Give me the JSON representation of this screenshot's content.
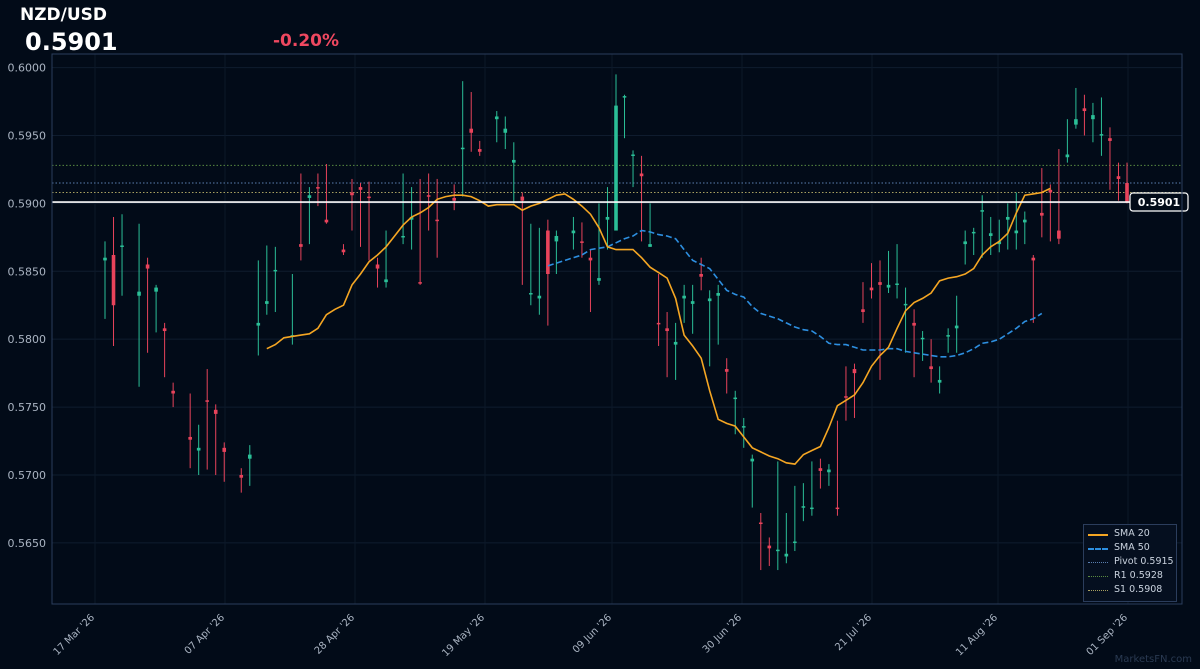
{
  "header": {
    "pair": "NZD/USD",
    "price": "0.5901",
    "change": "-0.20%"
  },
  "watermark": "MarketsFN.com",
  "colors": {
    "up": "#2bbf97",
    "down": "#e8435b",
    "sma20": "#f5a623",
    "sma50": "#2d8fe0",
    "pivot": "#5a7fb0",
    "r1": "#5a8a40",
    "s1": "#a8a060",
    "frame": "#2b3d5c"
  },
  "legend": [
    {
      "label": "SMA 20",
      "style": "sma20"
    },
    {
      "label": "SMA 50",
      "style": "sma50"
    },
    {
      "label": "Pivot 0.5915",
      "style": "pivot"
    },
    {
      "label": "R1 0.5928",
      "style": "r1"
    },
    {
      "label": "S1 0.5908",
      "style": "s1"
    }
  ],
  "chart_data": {
    "type": "candlestick",
    "title": "NZD/USD",
    "ylim": [
      0.5605,
      0.601
    ],
    "y_ticks": [
      0.565,
      0.57,
      0.575,
      0.58,
      0.585,
      0.59,
      0.595,
      0.6
    ],
    "y_tick_labels": [
      "0.5650",
      "0.5700",
      "0.5750",
      "0.5800",
      "0.5850",
      "0.5900",
      "0.5950",
      "0.6000"
    ],
    "x_tick_labels": [
      "17 Mar '26",
      "07 Apr '26",
      "28 Apr '26",
      "19 May '26",
      "09 Jun '26",
      "30 Jun '26",
      "21 Jul '26",
      "11 Aug '26",
      "01 Sep '26"
    ],
    "x_tick_index": [
      0,
      21,
      42,
      63,
      84,
      105,
      126,
      147,
      168
    ],
    "last_price": 0.5901,
    "last_price_label": "0.5901",
    "levels": [
      {
        "name": "Pivot",
        "value": 0.5915
      },
      {
        "name": "R1",
        "value": 0.5928
      },
      {
        "name": "S1",
        "value": 0.5908
      }
    ],
    "grid": true,
    "legend_position": "bottom-right",
    "days": 172,
    "series_candles_note": "OHLC per trading bar",
    "candles": [
      [
        0,
        0.5858,
        0.5872,
        0.5815,
        0.586
      ],
      [
        1,
        0.5862,
        0.589,
        0.5795,
        0.5825
      ],
      [
        2,
        0.5868,
        0.5892,
        0.5832,
        0.5869
      ],
      [
        4,
        0.5832,
        0.5885,
        0.5765,
        0.5835
      ],
      [
        5,
        0.5855,
        0.586,
        0.579,
        0.5852
      ],
      [
        6,
        0.5835,
        0.584,
        0.5805,
        0.5838
      ],
      [
        7,
        0.5808,
        0.5812,
        0.5772,
        0.5806
      ],
      [
        8,
        0.5762,
        0.5768,
        0.575,
        0.576
      ],
      [
        10,
        0.5728,
        0.576,
        0.5705,
        0.5726
      ],
      [
        11,
        0.5718,
        0.5737,
        0.57,
        0.572
      ],
      [
        12,
        0.5755,
        0.5778,
        0.5704,
        0.5754
      ],
      [
        13,
        0.5748,
        0.5752,
        0.57,
        0.5745
      ],
      [
        14,
        0.572,
        0.5724,
        0.5695,
        0.5717
      ],
      [
        16,
        0.57,
        0.5705,
        0.5687,
        0.5698
      ],
      [
        17,
        0.5712,
        0.5722,
        0.5692,
        0.5715
      ],
      [
        18,
        0.581,
        0.5858,
        0.5788,
        0.5812
      ],
      [
        19,
        0.5826,
        0.5869,
        0.5818,
        0.5828
      ],
      [
        20,
        0.585,
        0.5868,
        0.582,
        0.5851
      ],
      [
        22,
        0.5802,
        0.5848,
        0.5796,
        0.5803
      ],
      [
        23,
        0.587,
        0.5922,
        0.5858,
        0.5868
      ],
      [
        24,
        0.5904,
        0.5912,
        0.587,
        0.5906
      ],
      [
        25,
        0.5912,
        0.5922,
        0.5898,
        0.5911
      ],
      [
        26,
        0.5888,
        0.5929,
        0.5885,
        0.5886
      ],
      [
        28,
        0.5866,
        0.587,
        0.5862,
        0.5864
      ],
      [
        29,
        0.5908,
        0.5918,
        0.588,
        0.5906
      ],
      [
        30,
        0.5912,
        0.5915,
        0.5868,
        0.591
      ],
      [
        31,
        0.5905,
        0.5916,
        0.5858,
        0.5904
      ],
      [
        32,
        0.5855,
        0.586,
        0.5838,
        0.5852
      ],
      [
        33,
        0.5842,
        0.588,
        0.5838,
        0.5844
      ],
      [
        35,
        0.5875,
        0.5922,
        0.587,
        0.5876
      ],
      [
        36,
        0.5888,
        0.5912,
        0.5866,
        0.589
      ],
      [
        37,
        0.5842,
        0.5918,
        0.584,
        0.5841
      ],
      [
        38,
        0.5906,
        0.5922,
        0.588,
        0.5905
      ],
      [
        39,
        0.5888,
        0.5918,
        0.586,
        0.5887
      ],
      [
        41,
        0.5904,
        0.5914,
        0.5895,
        0.5902
      ],
      [
        42,
        0.594,
        0.599,
        0.5905,
        0.5941
      ],
      [
        43,
        0.5955,
        0.5982,
        0.5938,
        0.5952
      ],
      [
        44,
        0.594,
        0.5946,
        0.5935,
        0.5938
      ],
      [
        46,
        0.5962,
        0.5968,
        0.5945,
        0.5964
      ],
      [
        47,
        0.5952,
        0.5964,
        0.594,
        0.5955
      ],
      [
        48,
        0.593,
        0.5945,
        0.59,
        0.5932
      ],
      [
        49,
        0.5905,
        0.5908,
        0.584,
        0.5902
      ],
      [
        50,
        0.5833,
        0.5885,
        0.5825,
        0.5834
      ],
      [
        51,
        0.583,
        0.5882,
        0.5818,
        0.5832
      ],
      [
        52,
        0.588,
        0.5888,
        0.581,
        0.5848
      ],
      [
        53,
        0.5872,
        0.588,
        0.5848,
        0.5876
      ],
      [
        55,
        0.5878,
        0.589,
        0.5866,
        0.588
      ],
      [
        56,
        0.5872,
        0.5886,
        0.586,
        0.5871
      ],
      [
        57,
        0.586,
        0.5866,
        0.582,
        0.5858
      ],
      [
        58,
        0.5843,
        0.59,
        0.584,
        0.5845
      ],
      [
        59,
        0.5888,
        0.5912,
        0.5866,
        0.589
      ],
      [
        60,
        0.588,
        0.5995,
        0.5944,
        0.5972
      ],
      [
        61,
        0.5978,
        0.598,
        0.5948,
        0.5979
      ],
      [
        62,
        0.5935,
        0.5939,
        0.5912,
        0.5936
      ],
      [
        63,
        0.5922,
        0.5935,
        0.5872,
        0.592
      ],
      [
        64,
        0.5868,
        0.59,
        0.5868,
        0.587
      ],
      [
        65,
        0.5812,
        0.5848,
        0.5795,
        0.5811
      ],
      [
        66,
        0.5808,
        0.582,
        0.5772,
        0.5806
      ],
      [
        67,
        0.5796,
        0.5812,
        0.577,
        0.5798
      ],
      [
        68,
        0.583,
        0.584,
        0.5812,
        0.5832
      ],
      [
        69,
        0.5826,
        0.584,
        0.5804,
        0.5828
      ],
      [
        70,
        0.5848,
        0.586,
        0.5836,
        0.5846
      ],
      [
        71,
        0.5828,
        0.5836,
        0.578,
        0.583
      ],
      [
        72,
        0.5832,
        0.584,
        0.5796,
        0.5834
      ],
      [
        73,
        0.5778,
        0.5786,
        0.576,
        0.5776
      ],
      [
        74,
        0.5756,
        0.5762,
        0.573,
        0.5757
      ],
      [
        75,
        0.5735,
        0.5742,
        0.572,
        0.5736
      ],
      [
        76,
        0.571,
        0.5715,
        0.5676,
        0.5712
      ],
      [
        77,
        0.5665,
        0.5672,
        0.563,
        0.5664
      ],
      [
        78,
        0.5648,
        0.5654,
        0.5633,
        0.5646
      ],
      [
        79,
        0.5644,
        0.571,
        0.563,
        0.5645
      ],
      [
        80,
        0.564,
        0.5672,
        0.5635,
        0.5642
      ],
      [
        81,
        0.565,
        0.5692,
        0.5644,
        0.5651
      ],
      [
        82,
        0.5676,
        0.5694,
        0.5666,
        0.5677
      ],
      [
        83,
        0.5675,
        0.571,
        0.567,
        0.5676
      ],
      [
        84,
        0.5705,
        0.5712,
        0.569,
        0.5703
      ],
      [
        85,
        0.5702,
        0.5708,
        0.5692,
        0.5704
      ],
      [
        86,
        0.5676,
        0.574,
        0.567,
        0.5675
      ],
      [
        87,
        0.5758,
        0.578,
        0.574,
        0.5757
      ],
      [
        88,
        0.5778,
        0.5782,
        0.5742,
        0.5775
      ],
      [
        89,
        0.5822,
        0.5842,
        0.5812,
        0.582
      ],
      [
        90,
        0.5838,
        0.5856,
        0.583,
        0.5836
      ],
      [
        91,
        0.5842,
        0.5858,
        0.577,
        0.584
      ],
      [
        92,
        0.5838,
        0.5865,
        0.5834,
        0.584
      ],
      [
        93,
        0.584,
        0.587,
        0.583,
        0.5841
      ],
      [
        94,
        0.5825,
        0.5838,
        0.579,
        0.5826
      ],
      [
        95,
        0.5812,
        0.5822,
        0.5772,
        0.581
      ],
      [
        96,
        0.58,
        0.5806,
        0.5784,
        0.5801
      ],
      [
        97,
        0.578,
        0.58,
        0.5768,
        0.5778
      ],
      [
        98,
        0.5768,
        0.578,
        0.576,
        0.577
      ],
      [
        99,
        0.5802,
        0.5808,
        0.579,
        0.5803
      ],
      [
        100,
        0.5808,
        0.5832,
        0.579,
        0.581
      ],
      [
        101,
        0.587,
        0.588,
        0.5855,
        0.5872
      ],
      [
        102,
        0.5878,
        0.5882,
        0.5862,
        0.5879
      ],
      [
        103,
        0.5894,
        0.5906,
        0.586,
        0.5895
      ],
      [
        104,
        0.5876,
        0.589,
        0.5862,
        0.5878
      ],
      [
        105,
        0.587,
        0.5888,
        0.5864,
        0.5872
      ],
      [
        106,
        0.5888,
        0.59,
        0.5866,
        0.589
      ],
      [
        107,
        0.5878,
        0.5908,
        0.5866,
        0.588
      ],
      [
        108,
        0.5886,
        0.5894,
        0.587,
        0.5888
      ],
      [
        109,
        0.586,
        0.5862,
        0.5812,
        0.5858
      ],
      [
        110,
        0.5893,
        0.5926,
        0.5875,
        0.5891
      ],
      [
        111,
        0.591,
        0.5914,
        0.5872,
        0.5908
      ],
      [
        112,
        0.588,
        0.594,
        0.587,
        0.5874
      ],
      [
        113,
        0.5934,
        0.5962,
        0.593,
        0.5936
      ],
      [
        114,
        0.5958,
        0.5985,
        0.5955,
        0.5962
      ],
      [
        115,
        0.597,
        0.598,
        0.595,
        0.5968
      ],
      [
        116,
        0.5962,
        0.5974,
        0.5945,
        0.5965
      ],
      [
        117,
        0.595,
        0.5978,
        0.5935,
        0.5951
      ],
      [
        118,
        0.5948,
        0.5956,
        0.591,
        0.5946
      ],
      [
        119,
        0.592,
        0.593,
        0.5902,
        0.5918
      ],
      [
        120,
        0.5915,
        0.593,
        0.59,
        0.5901
      ]
    ],
    "sma20": [
      [
        19,
        0.5793
      ],
      [
        20,
        0.5796
      ],
      [
        21,
        0.5801
      ],
      [
        23,
        0.5803
      ],
      [
        24,
        0.5804
      ],
      [
        25,
        0.5808
      ],
      [
        26,
        0.5818
      ],
      [
        27,
        0.5822
      ],
      [
        28,
        0.5825
      ],
      [
        29,
        0.584
      ],
      [
        30,
        0.5848
      ],
      [
        31,
        0.5857
      ],
      [
        32,
        0.5862
      ],
      [
        33,
        0.5868
      ],
      [
        34,
        0.5876
      ],
      [
        35,
        0.5884
      ],
      [
        36,
        0.589
      ],
      [
        37,
        0.5893
      ],
      [
        38,
        0.5897
      ],
      [
        39,
        0.5903
      ],
      [
        40,
        0.5905
      ],
      [
        41,
        0.5906
      ],
      [
        42,
        0.5906
      ],
      [
        43,
        0.5905
      ],
      [
        44,
        0.5902
      ],
      [
        45,
        0.5898
      ],
      [
        46,
        0.5899
      ],
      [
        47,
        0.5899
      ],
      [
        48,
        0.5899
      ],
      [
        49,
        0.5895
      ],
      [
        50,
        0.5898
      ],
      [
        51,
        0.59
      ],
      [
        52,
        0.5903
      ],
      [
        53,
        0.5906
      ],
      [
        54,
        0.5907
      ],
      [
        55,
        0.5903
      ],
      [
        56,
        0.5898
      ],
      [
        57,
        0.5892
      ],
      [
        58,
        0.5882
      ],
      [
        59,
        0.5868
      ],
      [
        60,
        0.5866
      ],
      [
        61,
        0.5866
      ],
      [
        62,
        0.5866
      ],
      [
        63,
        0.586
      ],
      [
        64,
        0.5853
      ],
      [
        65,
        0.5849
      ],
      [
        66,
        0.5845
      ],
      [
        67,
        0.583
      ],
      [
        68,
        0.5803
      ],
      [
        69,
        0.5795
      ],
      [
        70,
        0.5786
      ],
      [
        71,
        0.5762
      ],
      [
        72,
        0.5741
      ],
      [
        73,
        0.5738
      ],
      [
        74,
        0.5736
      ],
      [
        75,
        0.5728
      ],
      [
        76,
        0.572
      ],
      [
        77,
        0.5717
      ],
      [
        78,
        0.5714
      ],
      [
        79,
        0.5712
      ],
      [
        80,
        0.5709
      ],
      [
        81,
        0.5708
      ],
      [
        82,
        0.5715
      ],
      [
        83,
        0.5718
      ],
      [
        84,
        0.5721
      ],
      [
        85,
        0.5735
      ],
      [
        86,
        0.5751
      ],
      [
        87,
        0.5755
      ],
      [
        88,
        0.5759
      ],
      [
        89,
        0.5768
      ],
      [
        90,
        0.578
      ],
      [
        91,
        0.5788
      ],
      [
        92,
        0.5794
      ],
      [
        93,
        0.5808
      ],
      [
        94,
        0.5821
      ],
      [
        95,
        0.5827
      ],
      [
        96,
        0.583
      ],
      [
        97,
        0.5834
      ],
      [
        98,
        0.5843
      ],
      [
        99,
        0.5845
      ],
      [
        100,
        0.5846
      ],
      [
        101,
        0.5848
      ],
      [
        102,
        0.5852
      ],
      [
        103,
        0.5862
      ],
      [
        104,
        0.5868
      ],
      [
        105,
        0.5872
      ],
      [
        106,
        0.5878
      ],
      [
        107,
        0.5893
      ],
      [
        108,
        0.5906
      ],
      [
        109,
        0.5907
      ],
      [
        110,
        0.5908
      ],
      [
        111,
        0.5911
      ]
    ],
    "sma50": [
      [
        52,
        0.5854
      ],
      [
        53,
        0.5856
      ],
      [
        54,
        0.5858
      ],
      [
        55,
        0.586
      ],
      [
        56,
        0.5862
      ],
      [
        57,
        0.5866
      ],
      [
        58,
        0.5867
      ],
      [
        59,
        0.5868
      ],
      [
        60,
        0.5871
      ],
      [
        61,
        0.5874
      ],
      [
        62,
        0.5876
      ],
      [
        63,
        0.588
      ],
      [
        64,
        0.5879
      ],
      [
        65,
        0.5877
      ],
      [
        66,
        0.5876
      ],
      [
        67,
        0.5874
      ],
      [
        68,
        0.5866
      ],
      [
        69,
        0.5858
      ],
      [
        70,
        0.5855
      ],
      [
        71,
        0.5852
      ],
      [
        72,
        0.5844
      ],
      [
        73,
        0.5836
      ],
      [
        74,
        0.5833
      ],
      [
        75,
        0.5831
      ],
      [
        76,
        0.5824
      ],
      [
        77,
        0.5819
      ],
      [
        78,
        0.5817
      ],
      [
        79,
        0.5815
      ],
      [
        80,
        0.5812
      ],
      [
        81,
        0.5809
      ],
      [
        82,
        0.5807
      ],
      [
        83,
        0.5806
      ],
      [
        84,
        0.5802
      ],
      [
        85,
        0.5797
      ],
      [
        86,
        0.5796
      ],
      [
        87,
        0.5796
      ],
      [
        88,
        0.5794
      ],
      [
        89,
        0.5792
      ],
      [
        90,
        0.5792
      ],
      [
        91,
        0.5792
      ],
      [
        92,
        0.5793
      ],
      [
        93,
        0.5793
      ],
      [
        94,
        0.5791
      ],
      [
        95,
        0.579
      ],
      [
        96,
        0.5789
      ],
      [
        97,
        0.5788
      ],
      [
        98,
        0.5787
      ],
      [
        99,
        0.5787
      ],
      [
        100,
        0.5788
      ],
      [
        101,
        0.579
      ],
      [
        102,
        0.5793
      ],
      [
        103,
        0.5797
      ],
      [
        104,
        0.5798
      ],
      [
        105,
        0.58
      ],
      [
        106,
        0.5804
      ],
      [
        107,
        0.5808
      ],
      [
        108,
        0.5813
      ],
      [
        109,
        0.5815
      ],
      [
        110,
        0.5819
      ]
    ]
  }
}
